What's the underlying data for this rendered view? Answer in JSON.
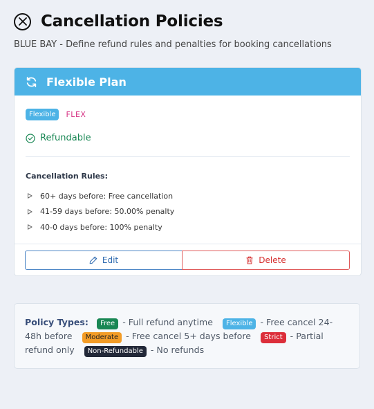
{
  "header": {
    "title": "Cancellation Policies",
    "subtitle": "BLUE BAY - Define refund rules and penalties for booking cancellations"
  },
  "policy": {
    "name": "Flexible Plan",
    "badge": "Flexible",
    "code": "FLEX",
    "status": "Refundable",
    "rules_heading": "Cancellation Rules:",
    "rules": [
      "60+ days before: Free cancellation",
      "41-59 days before: 50.00% penalty",
      "40-0 days before: 100% penalty"
    ],
    "edit_label": "Edit",
    "delete_label": "Delete"
  },
  "legend": {
    "title": "Policy Types:",
    "items": [
      {
        "badge": "Free",
        "desc": "- Full refund anytime"
      },
      {
        "badge": "Flexible",
        "desc": "- Free cancel 24-48h before"
      },
      {
        "badge": "Moderate",
        "desc": "- Free cancel 5+ days before"
      },
      {
        "badge": "Strict",
        "desc": "- Partial refund only"
      },
      {
        "badge": "Non-Refundable",
        "desc": "- No refunds"
      }
    ]
  },
  "colors": {
    "header_accent": "#4db3e6",
    "refundable": "#198754",
    "code": "#d63384",
    "edit": "#2f6bb0",
    "delete": "#d63030"
  },
  "icons": {
    "close": "close-circle-icon",
    "plan": "refresh-icon",
    "refundable": "check-circle-icon",
    "rule": "triangle-right-icon",
    "edit": "pencil-icon",
    "delete": "trash-icon"
  }
}
